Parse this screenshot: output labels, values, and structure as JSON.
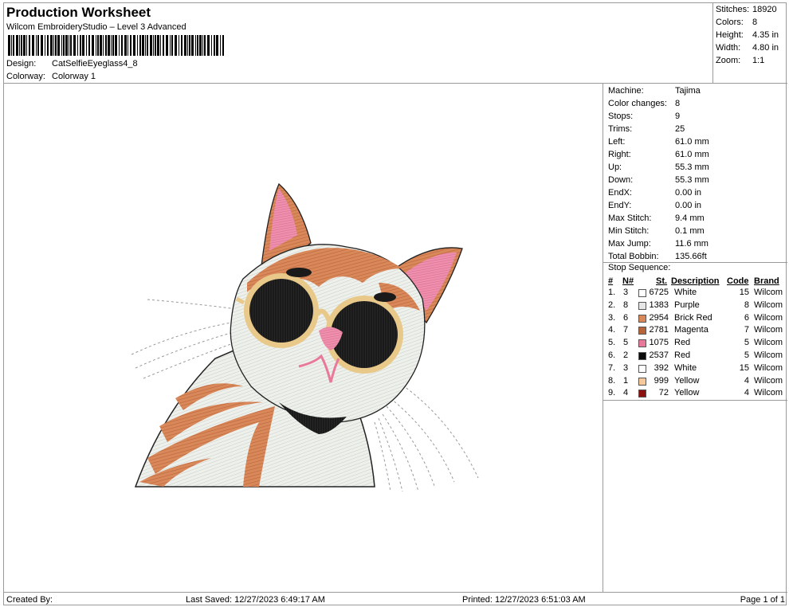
{
  "header": {
    "title": "Production Worksheet",
    "subtitle": "Wilcom EmbroideryStudio – Level 3 Advanced",
    "design_label": "Design:",
    "design_value": "CatSelfieEyeglass4_8",
    "colorway_label": "Colorway:",
    "colorway_value": "Colorway 1"
  },
  "summary": [
    {
      "label": "Stitches:",
      "value": "18920"
    },
    {
      "label": "Colors:",
      "value": "8"
    },
    {
      "label": "Height:",
      "value": "4.35 in"
    },
    {
      "label": "Width:",
      "value": "4.80 in"
    },
    {
      "label": "Zoom:",
      "value": "1:1"
    }
  ],
  "machine_info": [
    {
      "label": "Machine:",
      "value": "Tajima"
    },
    {
      "label": "Color changes:",
      "value": "8"
    },
    {
      "label": "Stops:",
      "value": "9"
    },
    {
      "label": "Trims:",
      "value": "25"
    },
    {
      "label": "Left:",
      "value": "61.0 mm"
    },
    {
      "label": "Right:",
      "value": "61.0 mm"
    },
    {
      "label": "Up:",
      "value": "55.3 mm"
    },
    {
      "label": "Down:",
      "value": "55.3 mm"
    },
    {
      "label": "EndX:",
      "value": "0.00 in"
    },
    {
      "label": "EndY:",
      "value": "0.00 in"
    },
    {
      "label": "Max Stitch:",
      "value": "9.4 mm"
    },
    {
      "label": "Min Stitch:",
      "value": "0.1 mm"
    },
    {
      "label": "Max Jump:",
      "value": "11.6 mm"
    },
    {
      "label": "Total Bobbin:",
      "value": "135.66ft"
    }
  ],
  "stop_sequence": {
    "title": "Stop Sequence:",
    "columns": {
      "num": "#",
      "n": "N#",
      "st": "St.",
      "description": "Description",
      "code": "Code",
      "brand": "Brand"
    },
    "rows": [
      {
        "num": "1.",
        "n": "3",
        "color": "#ffffff",
        "st": "6725",
        "description": "White",
        "code": "15",
        "brand": "Wilcom"
      },
      {
        "num": "2.",
        "n": "8",
        "color": "#e6e6e6",
        "st": "1383",
        "description": "Purple",
        "code": "8",
        "brand": "Wilcom"
      },
      {
        "num": "3.",
        "n": "6",
        "color": "#d9885a",
        "st": "2954",
        "description": "Brick Red",
        "code": "6",
        "brand": "Wilcom"
      },
      {
        "num": "4.",
        "n": "7",
        "color": "#b8643a",
        "st": "2781",
        "description": "Magenta",
        "code": "7",
        "brand": "Wilcom"
      },
      {
        "num": "5.",
        "n": "5",
        "color": "#e8799a",
        "st": "1075",
        "description": "Red",
        "code": "5",
        "brand": "Wilcom"
      },
      {
        "num": "6.",
        "n": "2",
        "color": "#0a0a0a",
        "st": "2537",
        "description": "Red",
        "code": "5",
        "brand": "Wilcom"
      },
      {
        "num": "7.",
        "n": "3",
        "color": "#ffffff",
        "st": "392",
        "description": "White",
        "code": "15",
        "brand": "Wilcom"
      },
      {
        "num": "8.",
        "n": "1",
        "color": "#f7c89a",
        "st": "999",
        "description": "Yellow",
        "code": "4",
        "brand": "Wilcom"
      },
      {
        "num": "9.",
        "n": "4",
        "color": "#8b1010",
        "st": "72",
        "description": "Yellow",
        "code": "4",
        "brand": "Wilcom"
      }
    ]
  },
  "footer": {
    "created_by": "Created By:",
    "last_saved": "Last Saved: 12/27/2023 6:49:17 AM",
    "printed": "Printed: 12/27/2023 6:51:03 AM",
    "page": "Page 1 of 1"
  }
}
